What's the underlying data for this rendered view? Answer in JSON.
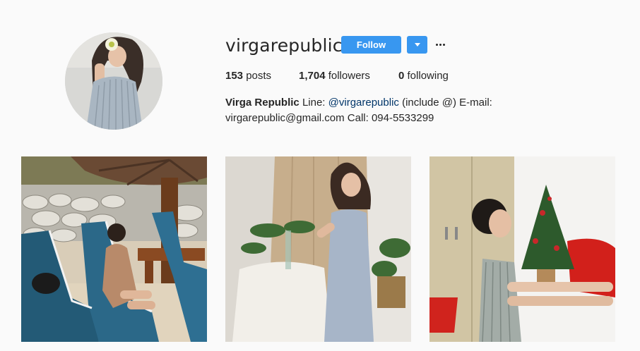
{
  "profile": {
    "username": "virgarepublic",
    "follow_label": "Follow",
    "more_label": "…"
  },
  "stats": {
    "posts_count": "153",
    "posts_label": "posts",
    "followers_count": "1,704",
    "followers_label": "followers",
    "following_count": "0",
    "following_label": "following"
  },
  "bio": {
    "name": "Virga Republic",
    "line_prefix": "Line: ",
    "handle": "@virgarepublic",
    "line_suffix": " (include @) E-mail: virgarepublic@gmail.com Call: 094-5533299"
  },
  "colors": {
    "accent": "#3897f0",
    "background": "#fafafa",
    "text": "#262626",
    "link": "#003569"
  },
  "icons": {
    "dropdown": "chevron-down-icon",
    "more": "more-options-icon"
  }
}
